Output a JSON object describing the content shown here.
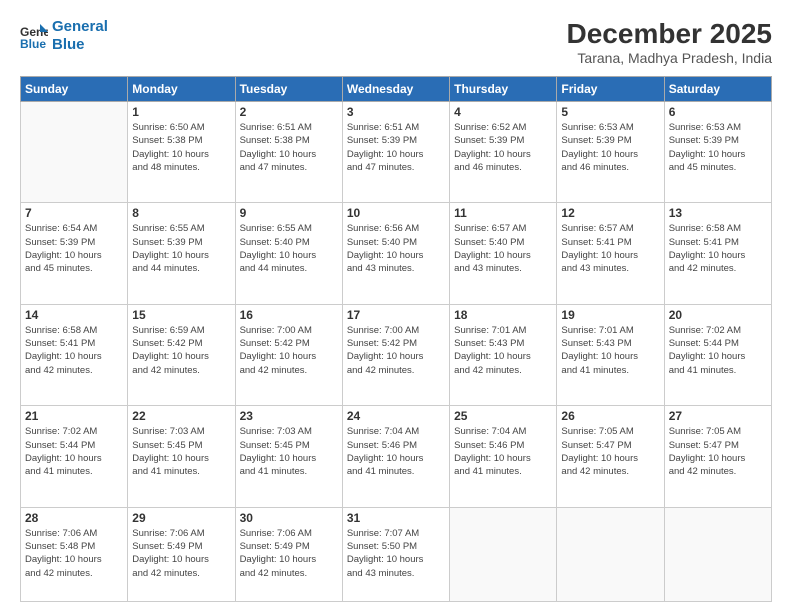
{
  "header": {
    "logo_line1": "General",
    "logo_line2": "Blue",
    "month": "December 2025",
    "location": "Tarana, Madhya Pradesh, India"
  },
  "weekdays": [
    "Sunday",
    "Monday",
    "Tuesday",
    "Wednesday",
    "Thursday",
    "Friday",
    "Saturday"
  ],
  "weeks": [
    [
      {
        "day": "",
        "info": ""
      },
      {
        "day": "1",
        "info": "Sunrise: 6:50 AM\nSunset: 5:38 PM\nDaylight: 10 hours\nand 48 minutes."
      },
      {
        "day": "2",
        "info": "Sunrise: 6:51 AM\nSunset: 5:38 PM\nDaylight: 10 hours\nand 47 minutes."
      },
      {
        "day": "3",
        "info": "Sunrise: 6:51 AM\nSunset: 5:39 PM\nDaylight: 10 hours\nand 47 minutes."
      },
      {
        "day": "4",
        "info": "Sunrise: 6:52 AM\nSunset: 5:39 PM\nDaylight: 10 hours\nand 46 minutes."
      },
      {
        "day": "5",
        "info": "Sunrise: 6:53 AM\nSunset: 5:39 PM\nDaylight: 10 hours\nand 46 minutes."
      },
      {
        "day": "6",
        "info": "Sunrise: 6:53 AM\nSunset: 5:39 PM\nDaylight: 10 hours\nand 45 minutes."
      }
    ],
    [
      {
        "day": "7",
        "info": "Sunrise: 6:54 AM\nSunset: 5:39 PM\nDaylight: 10 hours\nand 45 minutes."
      },
      {
        "day": "8",
        "info": "Sunrise: 6:55 AM\nSunset: 5:39 PM\nDaylight: 10 hours\nand 44 minutes."
      },
      {
        "day": "9",
        "info": "Sunrise: 6:55 AM\nSunset: 5:40 PM\nDaylight: 10 hours\nand 44 minutes."
      },
      {
        "day": "10",
        "info": "Sunrise: 6:56 AM\nSunset: 5:40 PM\nDaylight: 10 hours\nand 43 minutes."
      },
      {
        "day": "11",
        "info": "Sunrise: 6:57 AM\nSunset: 5:40 PM\nDaylight: 10 hours\nand 43 minutes."
      },
      {
        "day": "12",
        "info": "Sunrise: 6:57 AM\nSunset: 5:41 PM\nDaylight: 10 hours\nand 43 minutes."
      },
      {
        "day": "13",
        "info": "Sunrise: 6:58 AM\nSunset: 5:41 PM\nDaylight: 10 hours\nand 42 minutes."
      }
    ],
    [
      {
        "day": "14",
        "info": "Sunrise: 6:58 AM\nSunset: 5:41 PM\nDaylight: 10 hours\nand 42 minutes."
      },
      {
        "day": "15",
        "info": "Sunrise: 6:59 AM\nSunset: 5:42 PM\nDaylight: 10 hours\nand 42 minutes."
      },
      {
        "day": "16",
        "info": "Sunrise: 7:00 AM\nSunset: 5:42 PM\nDaylight: 10 hours\nand 42 minutes."
      },
      {
        "day": "17",
        "info": "Sunrise: 7:00 AM\nSunset: 5:42 PM\nDaylight: 10 hours\nand 42 minutes."
      },
      {
        "day": "18",
        "info": "Sunrise: 7:01 AM\nSunset: 5:43 PM\nDaylight: 10 hours\nand 42 minutes."
      },
      {
        "day": "19",
        "info": "Sunrise: 7:01 AM\nSunset: 5:43 PM\nDaylight: 10 hours\nand 41 minutes."
      },
      {
        "day": "20",
        "info": "Sunrise: 7:02 AM\nSunset: 5:44 PM\nDaylight: 10 hours\nand 41 minutes."
      }
    ],
    [
      {
        "day": "21",
        "info": "Sunrise: 7:02 AM\nSunset: 5:44 PM\nDaylight: 10 hours\nand 41 minutes."
      },
      {
        "day": "22",
        "info": "Sunrise: 7:03 AM\nSunset: 5:45 PM\nDaylight: 10 hours\nand 41 minutes."
      },
      {
        "day": "23",
        "info": "Sunrise: 7:03 AM\nSunset: 5:45 PM\nDaylight: 10 hours\nand 41 minutes."
      },
      {
        "day": "24",
        "info": "Sunrise: 7:04 AM\nSunset: 5:46 PM\nDaylight: 10 hours\nand 41 minutes."
      },
      {
        "day": "25",
        "info": "Sunrise: 7:04 AM\nSunset: 5:46 PM\nDaylight: 10 hours\nand 41 minutes."
      },
      {
        "day": "26",
        "info": "Sunrise: 7:05 AM\nSunset: 5:47 PM\nDaylight: 10 hours\nand 42 minutes."
      },
      {
        "day": "27",
        "info": "Sunrise: 7:05 AM\nSunset: 5:47 PM\nDaylight: 10 hours\nand 42 minutes."
      }
    ],
    [
      {
        "day": "28",
        "info": "Sunrise: 7:06 AM\nSunset: 5:48 PM\nDaylight: 10 hours\nand 42 minutes."
      },
      {
        "day": "29",
        "info": "Sunrise: 7:06 AM\nSunset: 5:49 PM\nDaylight: 10 hours\nand 42 minutes."
      },
      {
        "day": "30",
        "info": "Sunrise: 7:06 AM\nSunset: 5:49 PM\nDaylight: 10 hours\nand 42 minutes."
      },
      {
        "day": "31",
        "info": "Sunrise: 7:07 AM\nSunset: 5:50 PM\nDaylight: 10 hours\nand 43 minutes."
      },
      {
        "day": "",
        "info": ""
      },
      {
        "day": "",
        "info": ""
      },
      {
        "day": "",
        "info": ""
      }
    ]
  ]
}
